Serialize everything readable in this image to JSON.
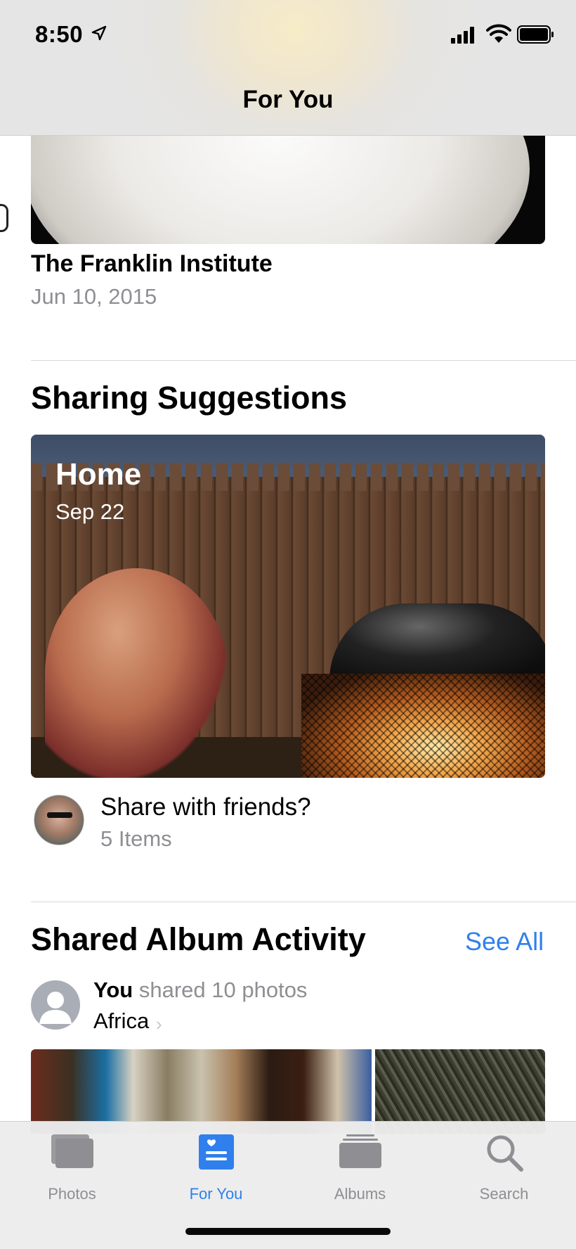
{
  "status": {
    "time": "8:50"
  },
  "nav": {
    "title": "For You"
  },
  "memory": {
    "title": "The Franklin Institute",
    "date": "Jun 10, 2015"
  },
  "sharing": {
    "section_title": "Sharing Suggestions",
    "card_title": "Home",
    "card_date": "Sep 22",
    "prompt": "Share with friends?",
    "count": "5 Items"
  },
  "activity": {
    "section_title": "Shared Album Activity",
    "see_all": "See All",
    "actor": "You",
    "action": " shared 10 photos",
    "album": "Africa"
  },
  "tabs": [
    {
      "label": "Photos",
      "icon": "photos-icon",
      "active": false
    },
    {
      "label": "For You",
      "icon": "for-you-icon",
      "active": true
    },
    {
      "label": "Albums",
      "icon": "albums-icon",
      "active": false
    },
    {
      "label": "Search",
      "icon": "search-icon",
      "active": false
    }
  ],
  "colors": {
    "accent": "#2f80ed",
    "secondary_text": "#8e8e93"
  }
}
